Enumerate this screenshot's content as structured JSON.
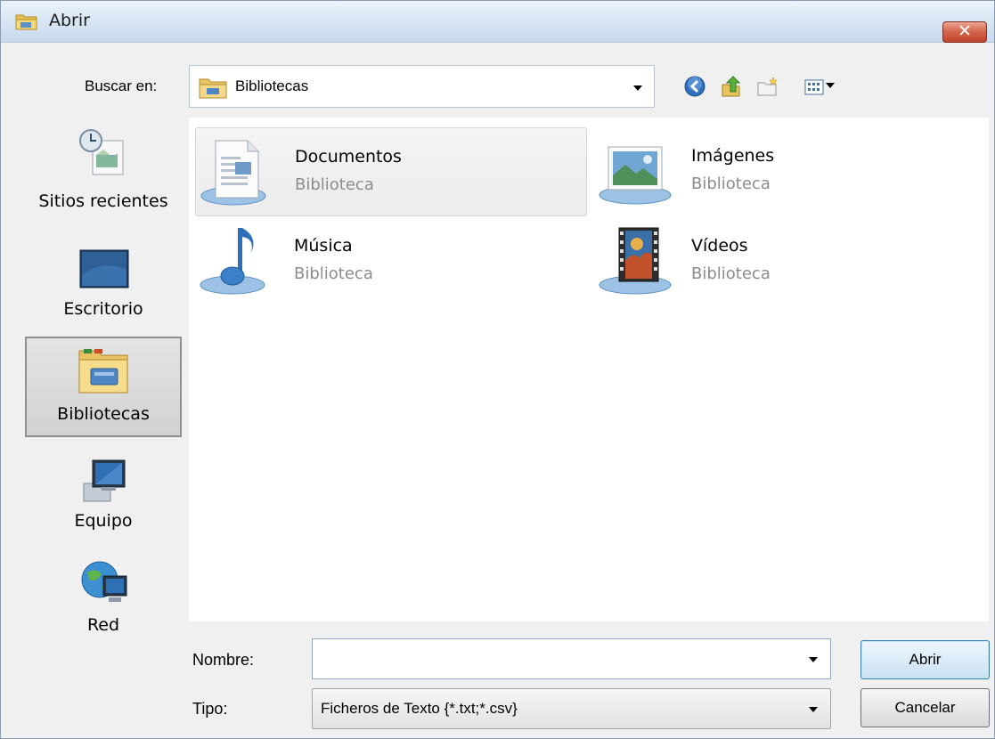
{
  "window": {
    "title": "Abrir",
    "close_glyph": "✕"
  },
  "lookin": {
    "label": "Buscar en:",
    "value": "Bibliotecas",
    "toolbar_icons": [
      "back-icon",
      "up-folder-icon",
      "new-folder-icon",
      "view-menu-icon"
    ]
  },
  "places": [
    {
      "label": "Sitios recientes",
      "icon": "recent-places-icon"
    },
    {
      "label": "Escritorio",
      "icon": "desktop-icon"
    },
    {
      "label": "Bibliotecas",
      "icon": "libraries-icon",
      "selected": true
    },
    {
      "label": "Equipo",
      "icon": "computer-icon"
    },
    {
      "label": "Red",
      "icon": "network-icon"
    }
  ],
  "items": [
    {
      "name": "Documentos",
      "type": "Biblioteca",
      "icon": "documents-library-icon",
      "hot": true
    },
    {
      "name": "Imágenes",
      "type": "Biblioteca",
      "icon": "pictures-library-icon"
    },
    {
      "name": "Música",
      "type": "Biblioteca",
      "icon": "music-library-icon"
    },
    {
      "name": "Vídeos",
      "type": "Biblioteca",
      "icon": "videos-library-icon"
    }
  ],
  "filename": {
    "label": "Nombre:",
    "value": ""
  },
  "filetype": {
    "label": "Tipo:",
    "value": "Ficheros de Texto {*.txt;*.csv}"
  },
  "buttons": {
    "open": "Abrir",
    "cancel": "Cancelar"
  },
  "colors": {
    "title_bar": "#d9e6f4",
    "close_button": "#c1432b",
    "accent": "#3c7fb1"
  }
}
